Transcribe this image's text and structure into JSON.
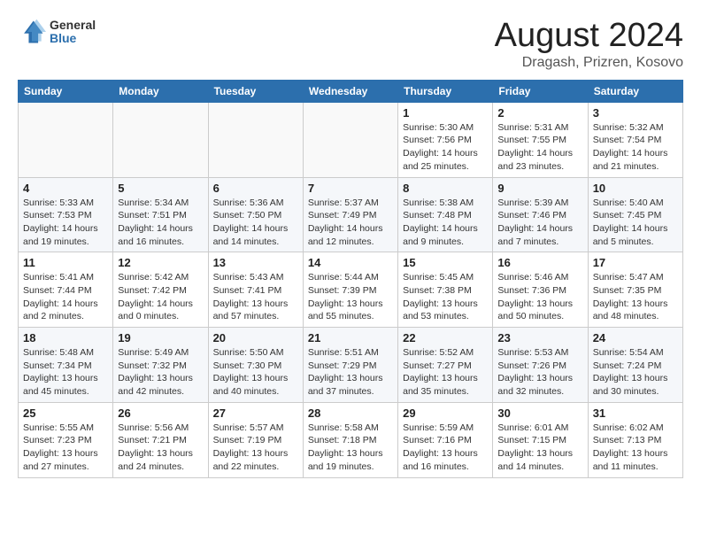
{
  "header": {
    "logo_line1": "General",
    "logo_line2": "Blue",
    "month_title": "August 2024",
    "location": "Dragash, Prizren, Kosovo"
  },
  "weekdays": [
    "Sunday",
    "Monday",
    "Tuesday",
    "Wednesday",
    "Thursday",
    "Friday",
    "Saturday"
  ],
  "weeks": [
    [
      {
        "day": "",
        "empty": true
      },
      {
        "day": "",
        "empty": true
      },
      {
        "day": "",
        "empty": true
      },
      {
        "day": "",
        "empty": true
      },
      {
        "day": "1",
        "sunrise": "5:30 AM",
        "sunset": "7:56 PM",
        "daylight": "14 hours and 25 minutes."
      },
      {
        "day": "2",
        "sunrise": "5:31 AM",
        "sunset": "7:55 PM",
        "daylight": "14 hours and 23 minutes."
      },
      {
        "day": "3",
        "sunrise": "5:32 AM",
        "sunset": "7:54 PM",
        "daylight": "14 hours and 21 minutes."
      }
    ],
    [
      {
        "day": "4",
        "sunrise": "5:33 AM",
        "sunset": "7:53 PM",
        "daylight": "14 hours and 19 minutes."
      },
      {
        "day": "5",
        "sunrise": "5:34 AM",
        "sunset": "7:51 PM",
        "daylight": "14 hours and 16 minutes."
      },
      {
        "day": "6",
        "sunrise": "5:36 AM",
        "sunset": "7:50 PM",
        "daylight": "14 hours and 14 minutes."
      },
      {
        "day": "7",
        "sunrise": "5:37 AM",
        "sunset": "7:49 PM",
        "daylight": "14 hours and 12 minutes."
      },
      {
        "day": "8",
        "sunrise": "5:38 AM",
        "sunset": "7:48 PM",
        "daylight": "14 hours and 9 minutes."
      },
      {
        "day": "9",
        "sunrise": "5:39 AM",
        "sunset": "7:46 PM",
        "daylight": "14 hours and 7 minutes."
      },
      {
        "day": "10",
        "sunrise": "5:40 AM",
        "sunset": "7:45 PM",
        "daylight": "14 hours and 5 minutes."
      }
    ],
    [
      {
        "day": "11",
        "sunrise": "5:41 AM",
        "sunset": "7:44 PM",
        "daylight": "14 hours and 2 minutes."
      },
      {
        "day": "12",
        "sunrise": "5:42 AM",
        "sunset": "7:42 PM",
        "daylight": "14 hours and 0 minutes."
      },
      {
        "day": "13",
        "sunrise": "5:43 AM",
        "sunset": "7:41 PM",
        "daylight": "13 hours and 57 minutes."
      },
      {
        "day": "14",
        "sunrise": "5:44 AM",
        "sunset": "7:39 PM",
        "daylight": "13 hours and 55 minutes."
      },
      {
        "day": "15",
        "sunrise": "5:45 AM",
        "sunset": "7:38 PM",
        "daylight": "13 hours and 53 minutes."
      },
      {
        "day": "16",
        "sunrise": "5:46 AM",
        "sunset": "7:36 PM",
        "daylight": "13 hours and 50 minutes."
      },
      {
        "day": "17",
        "sunrise": "5:47 AM",
        "sunset": "7:35 PM",
        "daylight": "13 hours and 48 minutes."
      }
    ],
    [
      {
        "day": "18",
        "sunrise": "5:48 AM",
        "sunset": "7:34 PM",
        "daylight": "13 hours and 45 minutes."
      },
      {
        "day": "19",
        "sunrise": "5:49 AM",
        "sunset": "7:32 PM",
        "daylight": "13 hours and 42 minutes."
      },
      {
        "day": "20",
        "sunrise": "5:50 AM",
        "sunset": "7:30 PM",
        "daylight": "13 hours and 40 minutes."
      },
      {
        "day": "21",
        "sunrise": "5:51 AM",
        "sunset": "7:29 PM",
        "daylight": "13 hours and 37 minutes."
      },
      {
        "day": "22",
        "sunrise": "5:52 AM",
        "sunset": "7:27 PM",
        "daylight": "13 hours and 35 minutes."
      },
      {
        "day": "23",
        "sunrise": "5:53 AM",
        "sunset": "7:26 PM",
        "daylight": "13 hours and 32 minutes."
      },
      {
        "day": "24",
        "sunrise": "5:54 AM",
        "sunset": "7:24 PM",
        "daylight": "13 hours and 30 minutes."
      }
    ],
    [
      {
        "day": "25",
        "sunrise": "5:55 AM",
        "sunset": "7:23 PM",
        "daylight": "13 hours and 27 minutes."
      },
      {
        "day": "26",
        "sunrise": "5:56 AM",
        "sunset": "7:21 PM",
        "daylight": "13 hours and 24 minutes."
      },
      {
        "day": "27",
        "sunrise": "5:57 AM",
        "sunset": "7:19 PM",
        "daylight": "13 hours and 22 minutes."
      },
      {
        "day": "28",
        "sunrise": "5:58 AM",
        "sunset": "7:18 PM",
        "daylight": "13 hours and 19 minutes."
      },
      {
        "day": "29",
        "sunrise": "5:59 AM",
        "sunset": "7:16 PM",
        "daylight": "13 hours and 16 minutes."
      },
      {
        "day": "30",
        "sunrise": "6:01 AM",
        "sunset": "7:15 PM",
        "daylight": "13 hours and 14 minutes."
      },
      {
        "day": "31",
        "sunrise": "6:02 AM",
        "sunset": "7:13 PM",
        "daylight": "13 hours and 11 minutes."
      }
    ]
  ]
}
